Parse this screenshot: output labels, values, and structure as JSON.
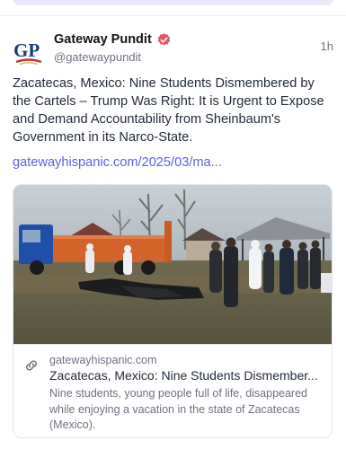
{
  "post": {
    "author_name": "Gateway Pundit",
    "author_handle": "@gatewaypundit",
    "avatar_text": "GP",
    "time": "1h",
    "text": "Zacatecas, Mexico: Nine Students Dismembered by the Cartels – Trump Was Right: It is Urgent to Expose and Demand Accountability from Sheinbaum's Government in its Narco-State.",
    "link": "gatewayhispanic.com/2025/03/ma...",
    "verified_icon": "verified-badge-icon"
  },
  "card": {
    "domain": "gatewayhispanic.com",
    "title": "Zacatecas, Mexico: Nine Students Dismember...",
    "description": "Nine students, young people full of life, disappeared while enjoying a vacation in the state of Zacatecas (Mexico).",
    "link_icon": "link-icon"
  },
  "colors": {
    "link": "#5b5fe8",
    "badge": "#e8536a",
    "muted_text": "#6b7280"
  }
}
